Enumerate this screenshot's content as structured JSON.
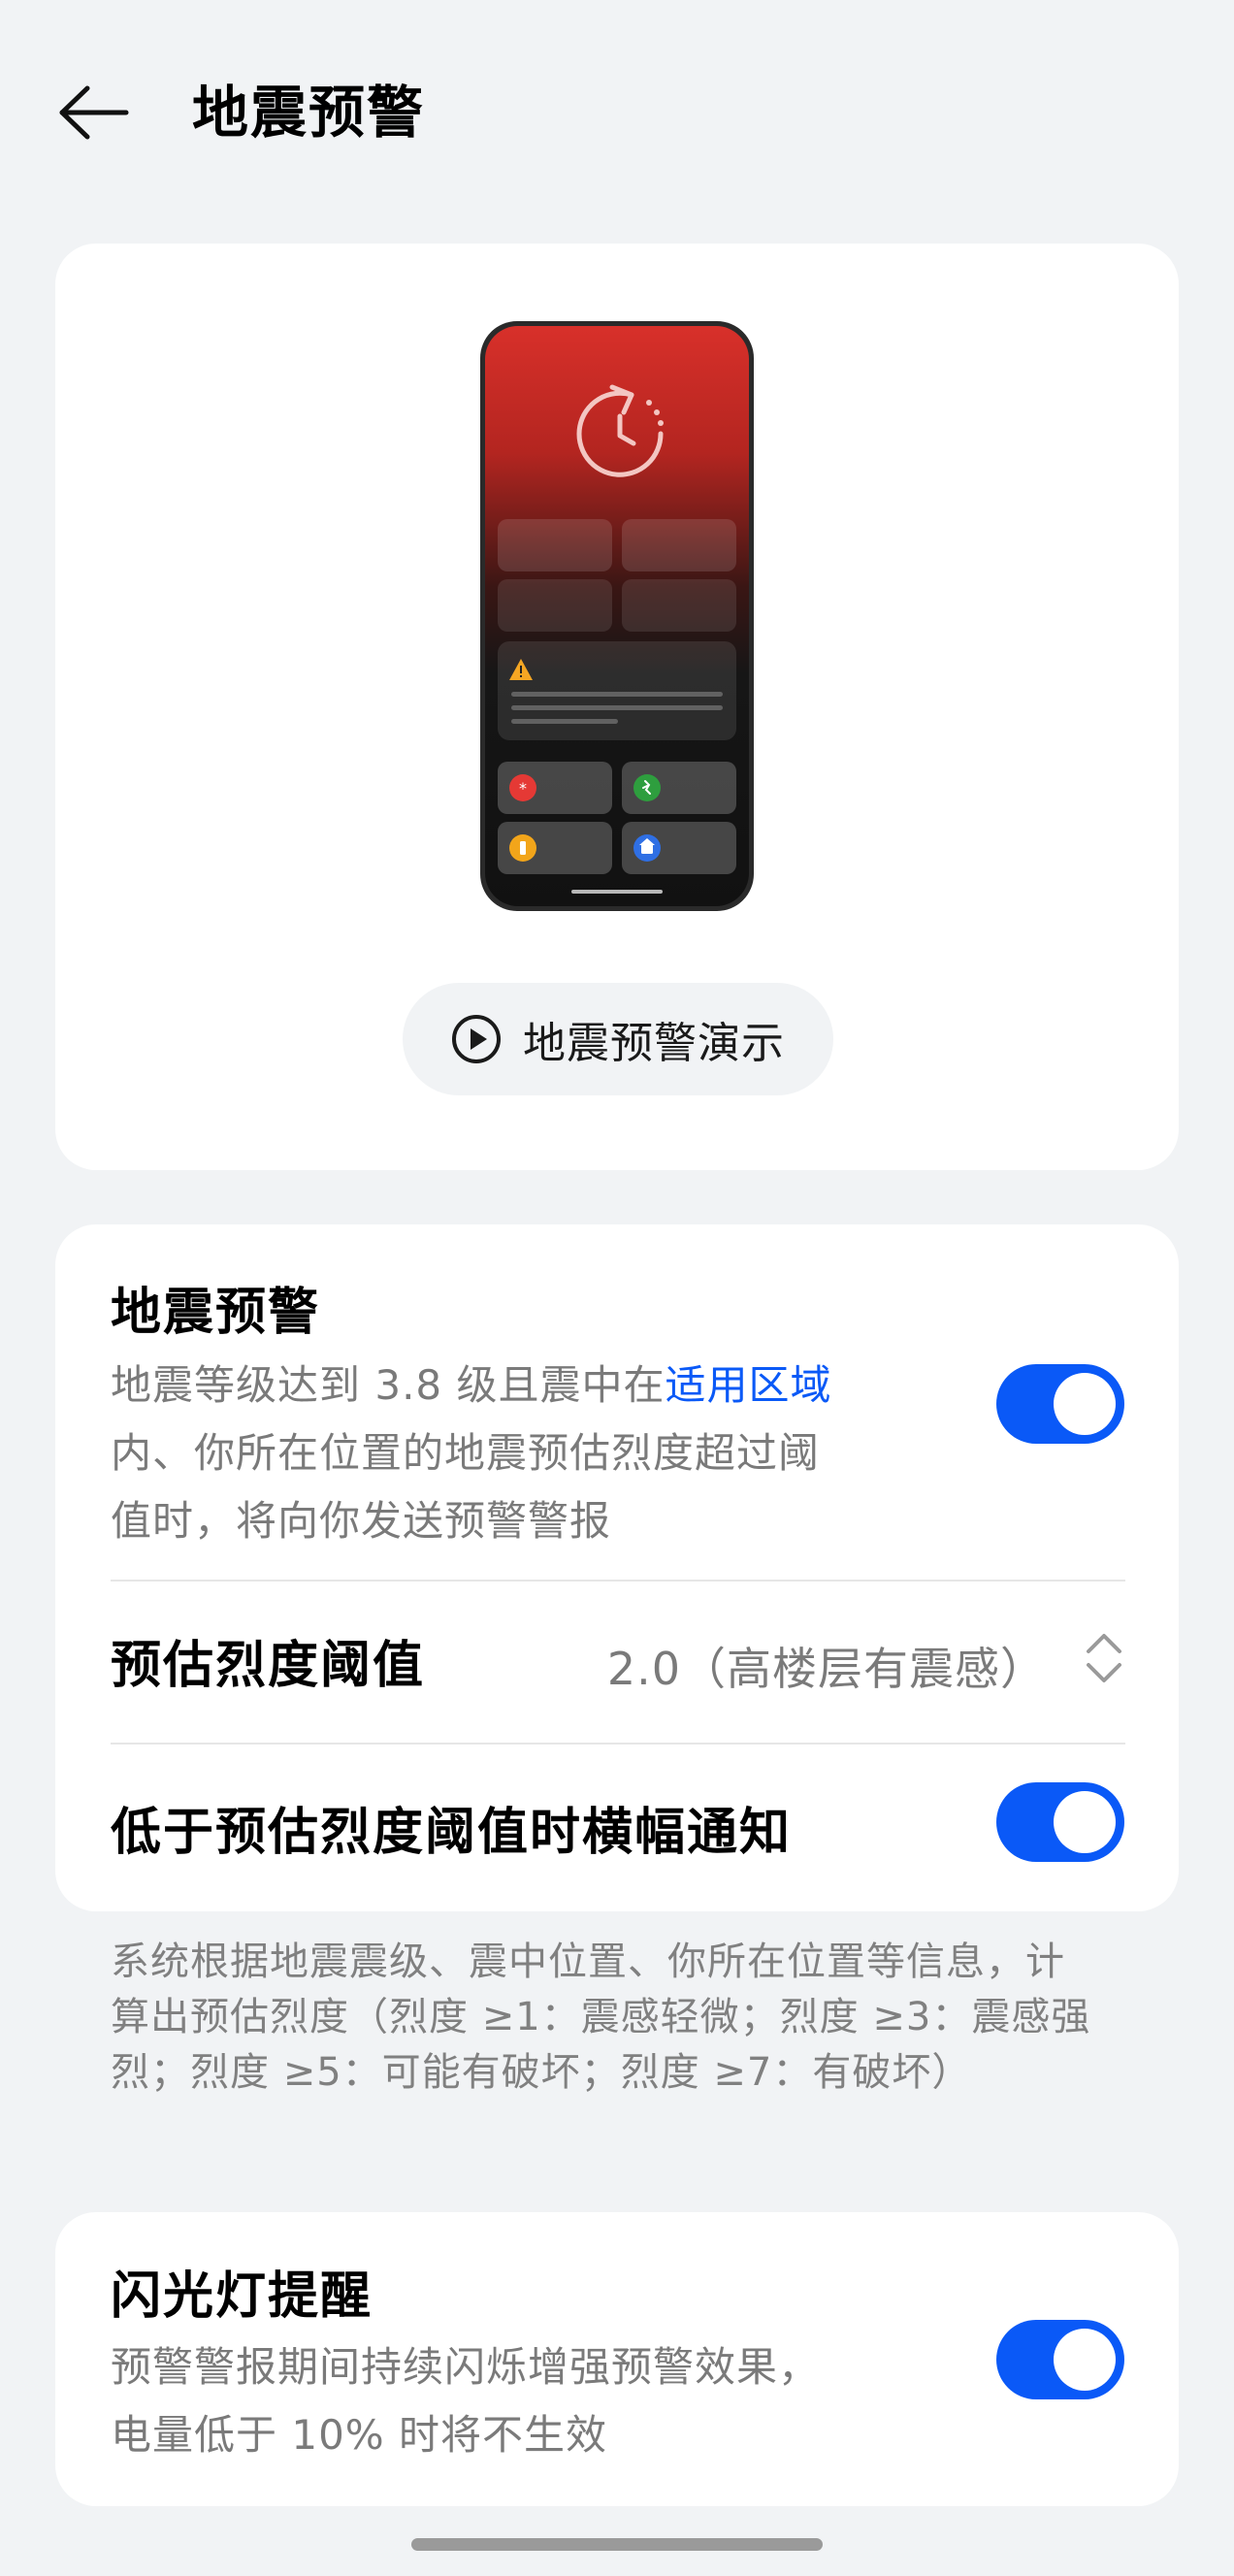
{
  "header": {
    "title": "地震预警"
  },
  "preview": {
    "demo_button_label": "地震预警演示"
  },
  "settings": {
    "earthquake_warning": {
      "title": "地震预警",
      "desc_prefix": "地震等级达到 3.8 级且震中在",
      "desc_link": "适用区域",
      "desc_line2": "内、你所在位置的地震预估烈度超过阈",
      "desc_line3": "值时，将向你发送预警警报",
      "enabled": true
    },
    "threshold": {
      "label": "预估烈度阈值",
      "value": "2.0（高楼层有震感）"
    },
    "below_threshold_banner": {
      "label": "低于预估烈度阈值时横幅通知",
      "enabled": true
    }
  },
  "footnote": {
    "line1": "系统根据地震震级、震中位置、你所在位置等信息，计",
    "line2": "算出预估烈度（烈度 ≥1：震感轻微；烈度 ≥3：震感强",
    "line3": "烈；烈度 ≥5：可能有破坏；烈度 ≥7：有破坏）"
  },
  "flash": {
    "title": "闪光灯提醒",
    "desc_line1": "预警警报期间持续闪烁增强预警效果，",
    "desc_line2": "电量低于 10% 时将不生效",
    "enabled": true
  },
  "colors": {
    "accent": "#0a59f7",
    "background": "#f1f3f5",
    "card": "#ffffff",
    "secondary_text": "#7a7a7a"
  }
}
